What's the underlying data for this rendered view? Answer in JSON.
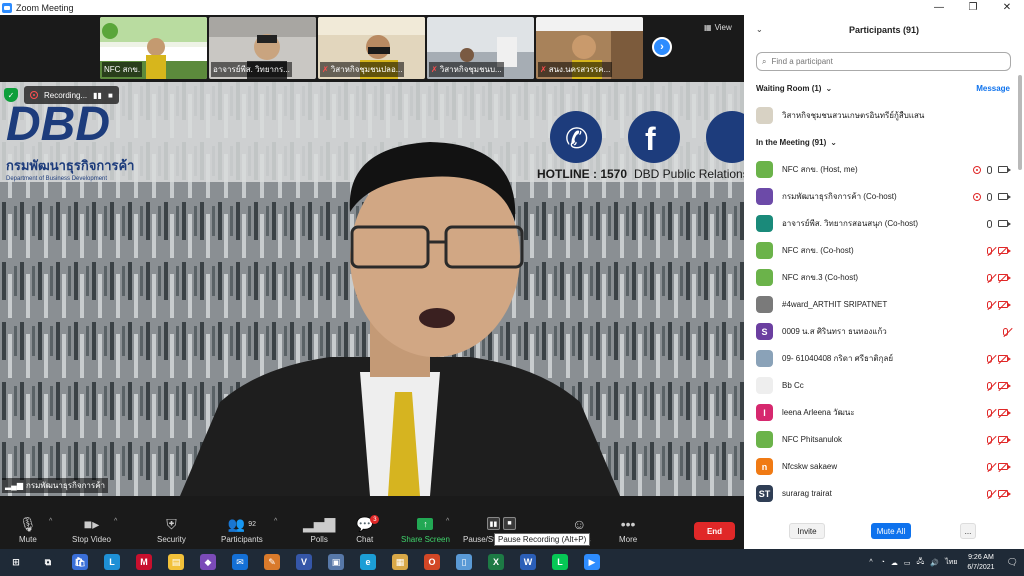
{
  "window": {
    "title": "Zoom Meeting",
    "controls": [
      "—",
      "❐",
      "✕"
    ]
  },
  "gallery": {
    "thumbs": [
      {
        "name": "NFC สกข.",
        "muted": false,
        "bg": "#8fc27a"
      },
      {
        "name": "อาจารย์พีส. วิทยากร...",
        "muted": false,
        "bg": "#b9b7b4"
      },
      {
        "name": "วิสาหกิจชุมชนปลอ...",
        "muted": true,
        "bg": "#d9b66d"
      },
      {
        "name": "วิสาหกิจชุมชนบ...",
        "muted": true,
        "bg": "#cfd3d6"
      },
      {
        "name": "สนง.นครสวรรค...",
        "muted": true,
        "bg": "#bf9c6c"
      }
    ],
    "view_label": "View"
  },
  "main_video": {
    "speaker_name": "กรมพัฒนาธุรกิจการค้า",
    "wall_logo": "DBD",
    "wall_logo_sub_th": "กรมพัฒนาธุรกิจการค้า",
    "wall_logo_sub_en": "Department of Business Development",
    "hotline": "HOTLINE : 1570",
    "pr_text": "DBD Public Relations",
    "recording_label": "Recording..."
  },
  "toolbar": {
    "items": [
      {
        "label": "Mute",
        "icon": "microphone-icon"
      },
      {
        "label": "Stop Video",
        "icon": "video-camera-icon"
      },
      {
        "label": "Security",
        "icon": "shield-icon"
      },
      {
        "label": "Participants",
        "icon": "participants-icon",
        "count": "92"
      },
      {
        "label": "Polls",
        "icon": "bar-chart-icon"
      },
      {
        "label": "Chat",
        "icon": "chat-bubble-icon",
        "badge": "3"
      },
      {
        "label": "Share Screen",
        "icon": "share-arrow-icon"
      },
      {
        "label": "Pause/St",
        "icon": "pause-icon"
      },
      {
        "label": "ns",
        "icon": "reactions-icon"
      },
      {
        "label": "More",
        "icon": "more-dots-icon"
      }
    ],
    "end_label": "End",
    "tooltip": "Pause Recording (Alt+P)"
  },
  "participants": {
    "header": "Participants (91)",
    "search_placeholder": "Find a participant",
    "waiting_room_label": "Waiting Room (1)",
    "message_label": "Message",
    "waiting": [
      {
        "name": "วิสาหกิจชุมชนสวนเกษตรอินทรีย์กู้สืบแสน",
        "avatar_color": "#d8d2c4"
      }
    ],
    "in_meeting_label": "In the Meeting (91)",
    "list": [
      {
        "name": "NFC สกข. (Host, me)",
        "avatar_color": "#6bb34a",
        "initial": "",
        "rec": true,
        "mic_off": false,
        "cam_off": false
      },
      {
        "name": "กรมพัฒนาธุรกิจการค้า (Co-host)",
        "avatar_color": "#6c4aa8",
        "initial": "",
        "rec": true,
        "mic_off": false,
        "cam_off": false
      },
      {
        "name": "อาจารย์พีส. วิทยากรสอนสนุก (Co-host)",
        "avatar_color": "#1a8a7a",
        "initial": "",
        "rec": false,
        "mic_off": false,
        "cam_off": false
      },
      {
        "name": "NFC สกข. (Co-host)",
        "avatar_color": "#6bb34a",
        "initial": "",
        "rec": false,
        "mic_off": true,
        "cam_off": true
      },
      {
        "name": "NFC สกข.3 (Co-host)",
        "avatar_color": "#6bb34a",
        "initial": "",
        "rec": false,
        "mic_off": true,
        "cam_off": true
      },
      {
        "name": "#4ward_ARTHIT SRIPATNET",
        "avatar_color": "#7a7a7a",
        "initial": "",
        "rec": false,
        "mic_off": true,
        "cam_off": true
      },
      {
        "name": "0009 น.ส ศิรินทรา ธนทองแก้ว",
        "avatar_color": "#6b3fa0",
        "initial": "S",
        "rec": false,
        "mic_off": true,
        "cam_off": false
      },
      {
        "name": "09- 61040408 กริดา ศรีธาติกุลย์",
        "avatar_color": "#8aa2b8",
        "initial": "",
        "rec": false,
        "mic_off": true,
        "cam_off": true
      },
      {
        "name": "Bb Cc",
        "avatar_color": "#eeeeee",
        "initial": "",
        "rec": false,
        "mic_off": true,
        "cam_off": true
      },
      {
        "name": "leena Arleena วัฒนะ",
        "avatar_color": "#d6286e",
        "initial": "l",
        "rec": false,
        "mic_off": true,
        "cam_off": true
      },
      {
        "name": "NFC Phitsanulok",
        "avatar_color": "#6bb34a",
        "initial": "",
        "rec": false,
        "mic_off": true,
        "cam_off": true
      },
      {
        "name": "Nfcskw sakaew",
        "avatar_color": "#f07a14",
        "initial": "n",
        "rec": false,
        "mic_off": true,
        "cam_off": true
      },
      {
        "name": "surarag trairat",
        "avatar_color": "#2f3e55",
        "initial": "ST",
        "rec": false,
        "mic_off": true,
        "cam_off": true
      }
    ],
    "invite_label": "Invite",
    "mute_all_label": "Mute All",
    "more_label": "..."
  },
  "taskbar": {
    "apps": [
      {
        "name": "start-icon",
        "color": "#1f2a37",
        "glyph": "⊞"
      },
      {
        "name": "task-view-icon",
        "color": "#1f2a37",
        "glyph": "⧉"
      },
      {
        "name": "store-icon",
        "color": "#3a6fd8",
        "glyph": "🛍"
      },
      {
        "name": "l-app-icon",
        "color": "#1e90d6",
        "glyph": "L"
      },
      {
        "name": "mcafee-icon",
        "color": "#c8102e",
        "glyph": "M"
      },
      {
        "name": "file-explorer-icon",
        "color": "#f2c13a",
        "glyph": "▤"
      },
      {
        "name": "visual-studio-icon",
        "color": "#7b4bb8",
        "glyph": "◆"
      },
      {
        "name": "mail-icon",
        "color": "#1470d6",
        "glyph": "✉"
      },
      {
        "name": "paint-icon",
        "color": "#d97a2b",
        "glyph": "✎"
      },
      {
        "name": "visio-icon",
        "color": "#3556a8",
        "glyph": "V"
      },
      {
        "name": "photos-icon",
        "color": "#5778a8",
        "glyph": "▣"
      },
      {
        "name": "edge-icon",
        "color": "#1c9ed6",
        "glyph": "e"
      },
      {
        "name": "app-icon",
        "color": "#d8a848",
        "glyph": "▦"
      },
      {
        "name": "office-icon",
        "color": "#d24726",
        "glyph": "O"
      },
      {
        "name": "notepad-icon",
        "color": "#5a9ad6",
        "glyph": "▯"
      },
      {
        "name": "excel-icon",
        "color": "#1d7a45",
        "glyph": "X"
      },
      {
        "name": "word-icon",
        "color": "#2b5fb8",
        "glyph": "W"
      },
      {
        "name": "line-icon",
        "color": "#06c755",
        "glyph": "L"
      },
      {
        "name": "zoom-icon",
        "color": "#2d8cff",
        "glyph": "▶"
      }
    ],
    "lang": "ไทย",
    "time": "9:26 AM",
    "date": "6/7/2021"
  }
}
